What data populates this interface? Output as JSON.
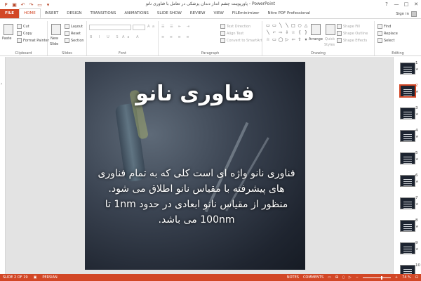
{
  "window": {
    "title": "پاورپوینت چشم انداز دندان پزشکی در تعامل با فناوری نانو - PowerPoint",
    "controls": [
      "?",
      "—",
      "□",
      "✕"
    ]
  },
  "qat": {
    "save_icon": "save-icon",
    "undo_icon": "undo-icon",
    "redo_icon": "redo-icon",
    "present_icon": "present-icon"
  },
  "tabs": [
    {
      "label": "FILE"
    },
    {
      "label": "HOME"
    },
    {
      "label": "INSERT"
    },
    {
      "label": "DESIGN"
    },
    {
      "label": "TRANSITIONS"
    },
    {
      "label": "ANIMATIONS"
    },
    {
      "label": "SLIDE SHOW"
    },
    {
      "label": "REVIEW"
    },
    {
      "label": "VIEW"
    },
    {
      "label": "FILEminimizer"
    },
    {
      "label": "Nitro PDF Professional"
    }
  ],
  "signin": {
    "label": "Sign in"
  },
  "ribbon": {
    "clipboard": {
      "paste": "Paste",
      "cut": "Cut",
      "copy": "Copy",
      "format_painter": "Format Painter",
      "label": "Clipboard"
    },
    "slides": {
      "new_slide": "New",
      "new_slide2": "Slide",
      "layout": "Layout",
      "reset": "Reset",
      "section": "Section",
      "label": "Slides"
    },
    "font": {
      "label": "Font"
    },
    "paragraph": {
      "text_direction": "Text Direction",
      "align_text": "Align Text",
      "convert": "Convert to SmartArt",
      "label": "Paragraph"
    },
    "drawing": {
      "arrange": "Arrange",
      "quick_styles": "Quick",
      "quick_styles2": "Styles",
      "shape_fill": "Shape Fill",
      "shape_outline": "Shape Outline",
      "shape_effects": "Shape Effects",
      "label": "Drawing"
    },
    "editing": {
      "find": "Find",
      "replace": "Replace",
      "select": "Select",
      "label": "Editing"
    }
  },
  "slide": {
    "title": "فناوری نانو",
    "body": "فناوری نانو واژه ای است کلی که به تمام فناوری های پیشرفته با مقیاس نانو اطلاق می شود. منظور از مقیاس نانو ابعادی در حدود 1nm تا 100nm می باشد."
  },
  "thumbnails": [
    {
      "num": "1"
    },
    {
      "num": "2"
    },
    {
      "num": "3"
    },
    {
      "num": "4"
    },
    {
      "num": "5"
    },
    {
      "num": "6"
    },
    {
      "num": "7"
    },
    {
      "num": "8"
    },
    {
      "num": "9"
    },
    {
      "num": "10"
    }
  ],
  "status": {
    "slide": "SLIDE 2 OF 19",
    "language": "PERSIAN",
    "notes": "NOTES",
    "comments": "COMMENTS",
    "zoom": "74 %"
  },
  "colors": {
    "accent": "#d24726"
  }
}
